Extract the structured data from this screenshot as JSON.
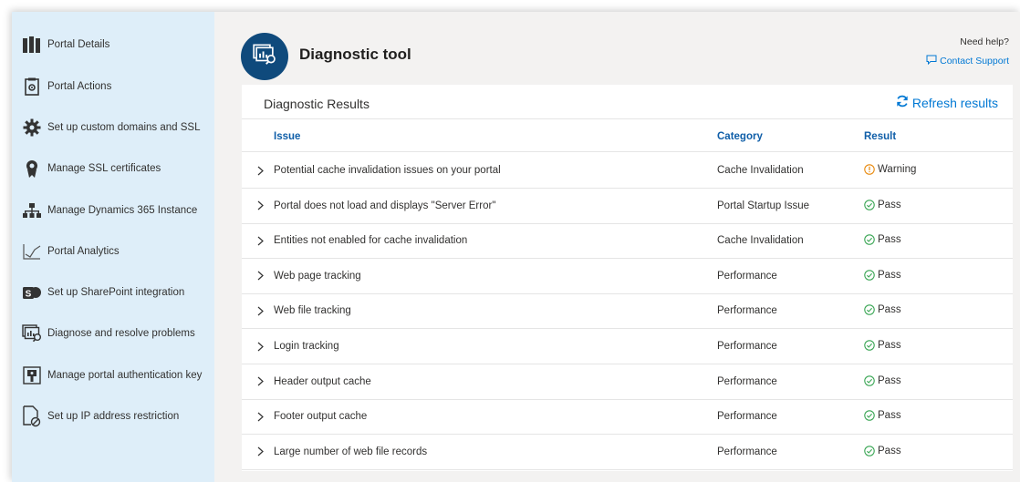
{
  "sidebar": {
    "items": [
      {
        "label": "Portal Details",
        "icon": "portal-details-icon"
      },
      {
        "label": "Portal Actions",
        "icon": "portal-actions-icon"
      },
      {
        "label": "Set up custom domains and SSL",
        "icon": "gear-icon"
      },
      {
        "label": "Manage SSL certificates",
        "icon": "certificate-icon"
      },
      {
        "label": "Manage Dynamics 365 Instance",
        "icon": "hierarchy-icon"
      },
      {
        "label": "Portal Analytics",
        "icon": "line-chart-icon"
      },
      {
        "label": "Set up SharePoint integration",
        "icon": "sharepoint-icon"
      },
      {
        "label": "Diagnose and resolve problems",
        "icon": "diagnostic-icon"
      },
      {
        "label": "Manage portal authentication key",
        "icon": "key-icon"
      },
      {
        "label": "Set up IP address restriction",
        "icon": "restricted-doc-icon"
      }
    ]
  },
  "header": {
    "title": "Diagnostic tool",
    "help_text": "Need help?",
    "contact_label": "Contact Support"
  },
  "results": {
    "title": "Diagnostic Results",
    "refresh_label": "Refresh results",
    "columns": {
      "issue": "Issue",
      "category": "Category",
      "result": "Result"
    },
    "rows": [
      {
        "issue": "Potential cache invalidation issues on your portal",
        "category": "Cache Invalidation",
        "result": "Warning",
        "status": "warning"
      },
      {
        "issue": "Portal does not load and displays \"Server Error\"",
        "category": "Portal Startup Issue",
        "result": "Pass",
        "status": "pass"
      },
      {
        "issue": "Entities not enabled for cache invalidation",
        "category": "Cache Invalidation",
        "result": "Pass",
        "status": "pass"
      },
      {
        "issue": "Web page tracking",
        "category": "Performance",
        "result": "Pass",
        "status": "pass"
      },
      {
        "issue": "Web file tracking",
        "category": "Performance",
        "result": "Pass",
        "status": "pass"
      },
      {
        "issue": "Login tracking",
        "category": "Performance",
        "result": "Pass",
        "status": "pass"
      },
      {
        "issue": "Header output cache",
        "category": "Performance",
        "result": "Pass",
        "status": "pass"
      },
      {
        "issue": "Footer output cache",
        "category": "Performance",
        "result": "Pass",
        "status": "pass"
      },
      {
        "issue": "Large number of web file records",
        "category": "Performance",
        "result": "Pass",
        "status": "pass"
      }
    ]
  },
  "colors": {
    "accent": "#0078d4",
    "badge": "#0f4a7c",
    "sidebar_bg": "#deeef9",
    "pass": "#3aa655",
    "warning": "#e8890c"
  }
}
